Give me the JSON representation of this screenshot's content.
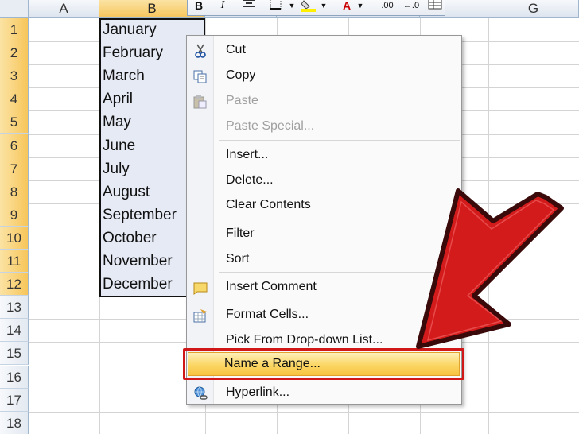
{
  "columns": [
    "A",
    "B",
    "",
    "",
    "",
    "",
    "G"
  ],
  "rows": [
    "1",
    "2",
    "3",
    "4",
    "5",
    "6",
    "7",
    "8",
    "9",
    "10",
    "11",
    "12",
    "13",
    "14",
    "15",
    "16",
    "17",
    "18"
  ],
  "cells_b": [
    "January",
    "February",
    "March",
    "April",
    "May",
    "June",
    "July",
    "August",
    "September",
    "October",
    "November",
    "December"
  ],
  "toolbar": {
    "bold": "B",
    "italic": "I",
    "font_color": "A",
    "decimal_inc": ".00",
    "decimal_dec": "←.0"
  },
  "menu": {
    "cut": "Cut",
    "copy": "Copy",
    "paste": "Paste",
    "paste_special": "Paste Special...",
    "insert": "Insert...",
    "delete": "Delete...",
    "clear_contents": "Clear Contents",
    "filter": "Filter",
    "sort": "Sort",
    "insert_comment": "Insert Comment",
    "format_cells": "Format Cells...",
    "pick_list": "Pick From Drop-down List...",
    "name_range": "Name a Range...",
    "hyperlink": "Hyperlink..."
  },
  "colors": {
    "highlight_border": "#d01818",
    "arrow": "#d41b1b",
    "selection": "#e6eaf5"
  }
}
